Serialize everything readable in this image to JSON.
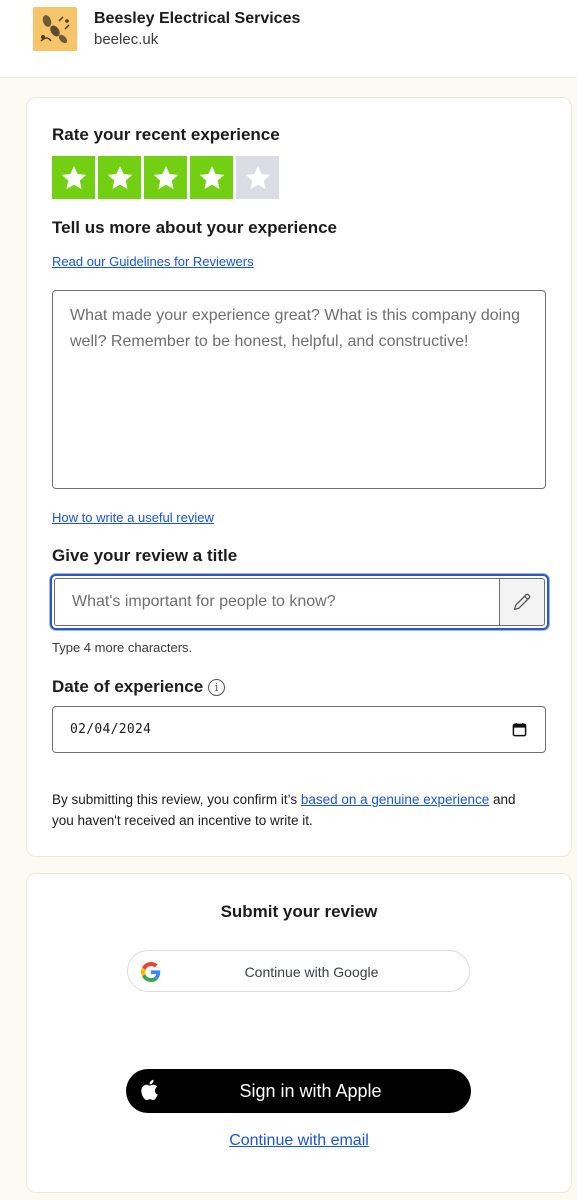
{
  "business": {
    "name": "Beesley Electrical Services",
    "url": "beelec.uk",
    "logo_icon": "bee-logo-icon"
  },
  "rating": {
    "heading": "Rate your recent experience",
    "value": 4,
    "max": 5,
    "on_color": "#73cf11",
    "off_color": "#dcdce6"
  },
  "experience": {
    "heading": "Tell us more about your experience",
    "guidelines_link": "Read our Guidelines for Reviewers",
    "placeholder": "What made your experience great? What is this company doing well? Remember to be honest, helpful, and constructive!",
    "useful_link": "How to write a useful review"
  },
  "review_title": {
    "heading": "Give your review a title",
    "placeholder": "What's important for people to know?",
    "hint": "Type 4 more characters.",
    "edit_icon": "pencil-icon",
    "focus_color": "#2b59c3"
  },
  "date": {
    "heading": "Date of experience",
    "info_icon": "info-icon",
    "value": "02/04/2024",
    "calendar_icon": "calendar-icon"
  },
  "consent": {
    "prefix": "By submitting this review, you confirm it’s ",
    "link": "based on a genuine experience",
    "suffix": " and you haven't received an incentive to write it."
  },
  "submit": {
    "heading": "Submit your review",
    "google_label": "Continue with Google",
    "apple_label": "Sign in with Apple",
    "email_link": "Continue with email"
  }
}
